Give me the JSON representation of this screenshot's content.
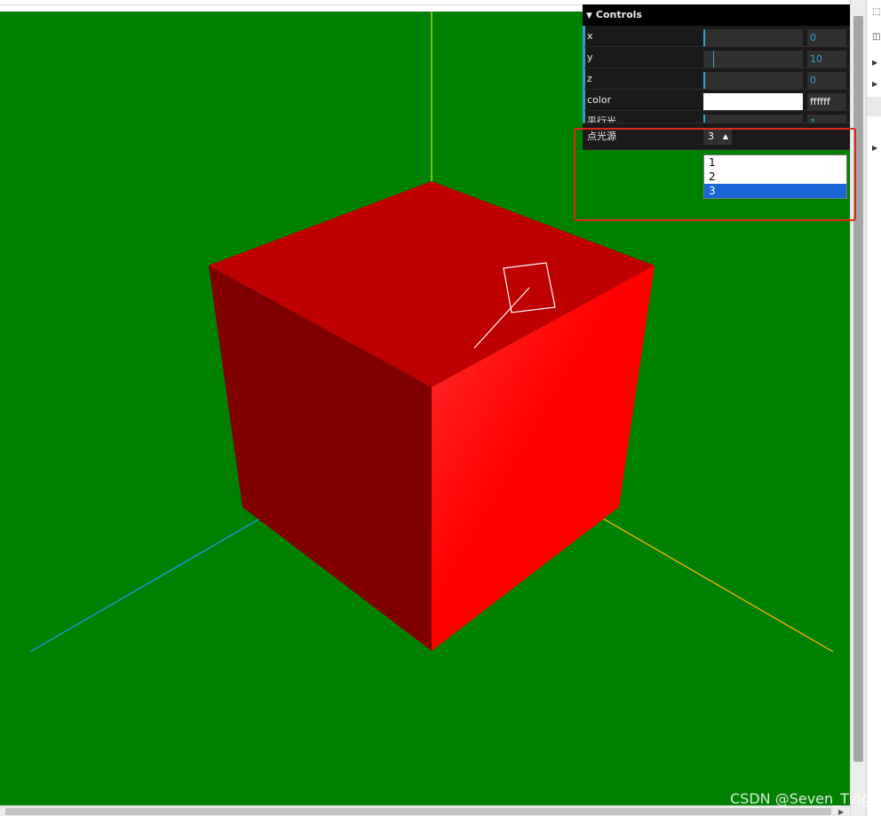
{
  "gui": {
    "title": "Controls",
    "rows": [
      {
        "label": "x",
        "value": "0",
        "fraction": 0
      },
      {
        "label": "y",
        "value": "10",
        "fraction": 0.1
      },
      {
        "label": "z",
        "value": "0",
        "fraction": 0
      }
    ],
    "color": {
      "label": "color",
      "value": "ffffff",
      "swatch": "#ffffff"
    },
    "directional": {
      "label": "平行光",
      "value": "1"
    },
    "point_light": {
      "label": "点光源",
      "selected": "3",
      "options": [
        "1",
        "2",
        "3"
      ]
    }
  },
  "scene": {
    "background": "#008000",
    "cube_colors": {
      "top": "#bf0000",
      "left": "#800000",
      "right": "#ff0000"
    },
    "axis_colors": {
      "x": "#ffb000",
      "y": "#9fdc00",
      "z": "#1a9cf0"
    },
    "light_helper_color": "#ffffff"
  },
  "watermark": "CSDN @Seven_Ting"
}
